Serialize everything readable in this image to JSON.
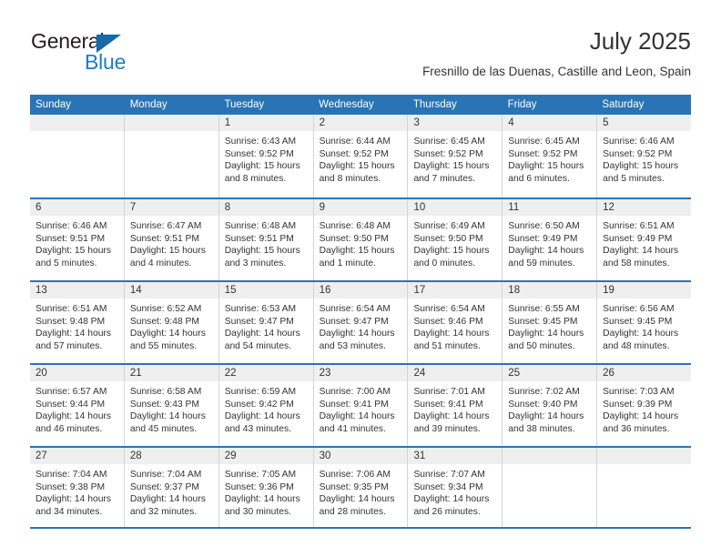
{
  "brand": {
    "name_part1": "General",
    "name_part2": "Blue",
    "logo_icon": "triangle-logo-icon",
    "accent_color": "#1c7cc4",
    "dark_color": "#231f20"
  },
  "header": {
    "month_title": "July 2025",
    "location": "Fresnillo de las Duenas, Castille and Leon, Spain"
  },
  "calendar": {
    "header_bg": "#2a74b5",
    "datestrip_bg": "#efefef",
    "grid_line": "#d4d4d4",
    "day_names": [
      "Sunday",
      "Monday",
      "Tuesday",
      "Wednesday",
      "Thursday",
      "Friday",
      "Saturday"
    ],
    "weeks": [
      [
        {
          "day": "",
          "sunrise": "",
          "sunset": "",
          "daylight_l1": "",
          "daylight_l2": ""
        },
        {
          "day": "",
          "sunrise": "",
          "sunset": "",
          "daylight_l1": "",
          "daylight_l2": ""
        },
        {
          "day": "1",
          "sunrise": "Sunrise: 6:43 AM",
          "sunset": "Sunset: 9:52 PM",
          "daylight_l1": "Daylight: 15 hours",
          "daylight_l2": "and 8 minutes."
        },
        {
          "day": "2",
          "sunrise": "Sunrise: 6:44 AM",
          "sunset": "Sunset: 9:52 PM",
          "daylight_l1": "Daylight: 15 hours",
          "daylight_l2": "and 8 minutes."
        },
        {
          "day": "3",
          "sunrise": "Sunrise: 6:45 AM",
          "sunset": "Sunset: 9:52 PM",
          "daylight_l1": "Daylight: 15 hours",
          "daylight_l2": "and 7 minutes."
        },
        {
          "day": "4",
          "sunrise": "Sunrise: 6:45 AM",
          "sunset": "Sunset: 9:52 PM",
          "daylight_l1": "Daylight: 15 hours",
          "daylight_l2": "and 6 minutes."
        },
        {
          "day": "5",
          "sunrise": "Sunrise: 6:46 AM",
          "sunset": "Sunset: 9:52 PM",
          "daylight_l1": "Daylight: 15 hours",
          "daylight_l2": "and 5 minutes."
        }
      ],
      [
        {
          "day": "6",
          "sunrise": "Sunrise: 6:46 AM",
          "sunset": "Sunset: 9:51 PM",
          "daylight_l1": "Daylight: 15 hours",
          "daylight_l2": "and 5 minutes."
        },
        {
          "day": "7",
          "sunrise": "Sunrise: 6:47 AM",
          "sunset": "Sunset: 9:51 PM",
          "daylight_l1": "Daylight: 15 hours",
          "daylight_l2": "and 4 minutes."
        },
        {
          "day": "8",
          "sunrise": "Sunrise: 6:48 AM",
          "sunset": "Sunset: 9:51 PM",
          "daylight_l1": "Daylight: 15 hours",
          "daylight_l2": "and 3 minutes."
        },
        {
          "day": "9",
          "sunrise": "Sunrise: 6:48 AM",
          "sunset": "Sunset: 9:50 PM",
          "daylight_l1": "Daylight: 15 hours",
          "daylight_l2": "and 1 minute."
        },
        {
          "day": "10",
          "sunrise": "Sunrise: 6:49 AM",
          "sunset": "Sunset: 9:50 PM",
          "daylight_l1": "Daylight: 15 hours",
          "daylight_l2": "and 0 minutes."
        },
        {
          "day": "11",
          "sunrise": "Sunrise: 6:50 AM",
          "sunset": "Sunset: 9:49 PM",
          "daylight_l1": "Daylight: 14 hours",
          "daylight_l2": "and 59 minutes."
        },
        {
          "day": "12",
          "sunrise": "Sunrise: 6:51 AM",
          "sunset": "Sunset: 9:49 PM",
          "daylight_l1": "Daylight: 14 hours",
          "daylight_l2": "and 58 minutes."
        }
      ],
      [
        {
          "day": "13",
          "sunrise": "Sunrise: 6:51 AM",
          "sunset": "Sunset: 9:48 PM",
          "daylight_l1": "Daylight: 14 hours",
          "daylight_l2": "and 57 minutes."
        },
        {
          "day": "14",
          "sunrise": "Sunrise: 6:52 AM",
          "sunset": "Sunset: 9:48 PM",
          "daylight_l1": "Daylight: 14 hours",
          "daylight_l2": "and 55 minutes."
        },
        {
          "day": "15",
          "sunrise": "Sunrise: 6:53 AM",
          "sunset": "Sunset: 9:47 PM",
          "daylight_l1": "Daylight: 14 hours",
          "daylight_l2": "and 54 minutes."
        },
        {
          "day": "16",
          "sunrise": "Sunrise: 6:54 AM",
          "sunset": "Sunset: 9:47 PM",
          "daylight_l1": "Daylight: 14 hours",
          "daylight_l2": "and 53 minutes."
        },
        {
          "day": "17",
          "sunrise": "Sunrise: 6:54 AM",
          "sunset": "Sunset: 9:46 PM",
          "daylight_l1": "Daylight: 14 hours",
          "daylight_l2": "and 51 minutes."
        },
        {
          "day": "18",
          "sunrise": "Sunrise: 6:55 AM",
          "sunset": "Sunset: 9:45 PM",
          "daylight_l1": "Daylight: 14 hours",
          "daylight_l2": "and 50 minutes."
        },
        {
          "day": "19",
          "sunrise": "Sunrise: 6:56 AM",
          "sunset": "Sunset: 9:45 PM",
          "daylight_l1": "Daylight: 14 hours",
          "daylight_l2": "and 48 minutes."
        }
      ],
      [
        {
          "day": "20",
          "sunrise": "Sunrise: 6:57 AM",
          "sunset": "Sunset: 9:44 PM",
          "daylight_l1": "Daylight: 14 hours",
          "daylight_l2": "and 46 minutes."
        },
        {
          "day": "21",
          "sunrise": "Sunrise: 6:58 AM",
          "sunset": "Sunset: 9:43 PM",
          "daylight_l1": "Daylight: 14 hours",
          "daylight_l2": "and 45 minutes."
        },
        {
          "day": "22",
          "sunrise": "Sunrise: 6:59 AM",
          "sunset": "Sunset: 9:42 PM",
          "daylight_l1": "Daylight: 14 hours",
          "daylight_l2": "and 43 minutes."
        },
        {
          "day": "23",
          "sunrise": "Sunrise: 7:00 AM",
          "sunset": "Sunset: 9:41 PM",
          "daylight_l1": "Daylight: 14 hours",
          "daylight_l2": "and 41 minutes."
        },
        {
          "day": "24",
          "sunrise": "Sunrise: 7:01 AM",
          "sunset": "Sunset: 9:41 PM",
          "daylight_l1": "Daylight: 14 hours",
          "daylight_l2": "and 39 minutes."
        },
        {
          "day": "25",
          "sunrise": "Sunrise: 7:02 AM",
          "sunset": "Sunset: 9:40 PM",
          "daylight_l1": "Daylight: 14 hours",
          "daylight_l2": "and 38 minutes."
        },
        {
          "day": "26",
          "sunrise": "Sunrise: 7:03 AM",
          "sunset": "Sunset: 9:39 PM",
          "daylight_l1": "Daylight: 14 hours",
          "daylight_l2": "and 36 minutes."
        }
      ],
      [
        {
          "day": "27",
          "sunrise": "Sunrise: 7:04 AM",
          "sunset": "Sunset: 9:38 PM",
          "daylight_l1": "Daylight: 14 hours",
          "daylight_l2": "and 34 minutes."
        },
        {
          "day": "28",
          "sunrise": "Sunrise: 7:04 AM",
          "sunset": "Sunset: 9:37 PM",
          "daylight_l1": "Daylight: 14 hours",
          "daylight_l2": "and 32 minutes."
        },
        {
          "day": "29",
          "sunrise": "Sunrise: 7:05 AM",
          "sunset": "Sunset: 9:36 PM",
          "daylight_l1": "Daylight: 14 hours",
          "daylight_l2": "and 30 minutes."
        },
        {
          "day": "30",
          "sunrise": "Sunrise: 7:06 AM",
          "sunset": "Sunset: 9:35 PM",
          "daylight_l1": "Daylight: 14 hours",
          "daylight_l2": "and 28 minutes."
        },
        {
          "day": "31",
          "sunrise": "Sunrise: 7:07 AM",
          "sunset": "Sunset: 9:34 PM",
          "daylight_l1": "Daylight: 14 hours",
          "daylight_l2": "and 26 minutes."
        },
        {
          "day": "",
          "sunrise": "",
          "sunset": "",
          "daylight_l1": "",
          "daylight_l2": ""
        },
        {
          "day": "",
          "sunrise": "",
          "sunset": "",
          "daylight_l1": "",
          "daylight_l2": ""
        }
      ]
    ]
  }
}
